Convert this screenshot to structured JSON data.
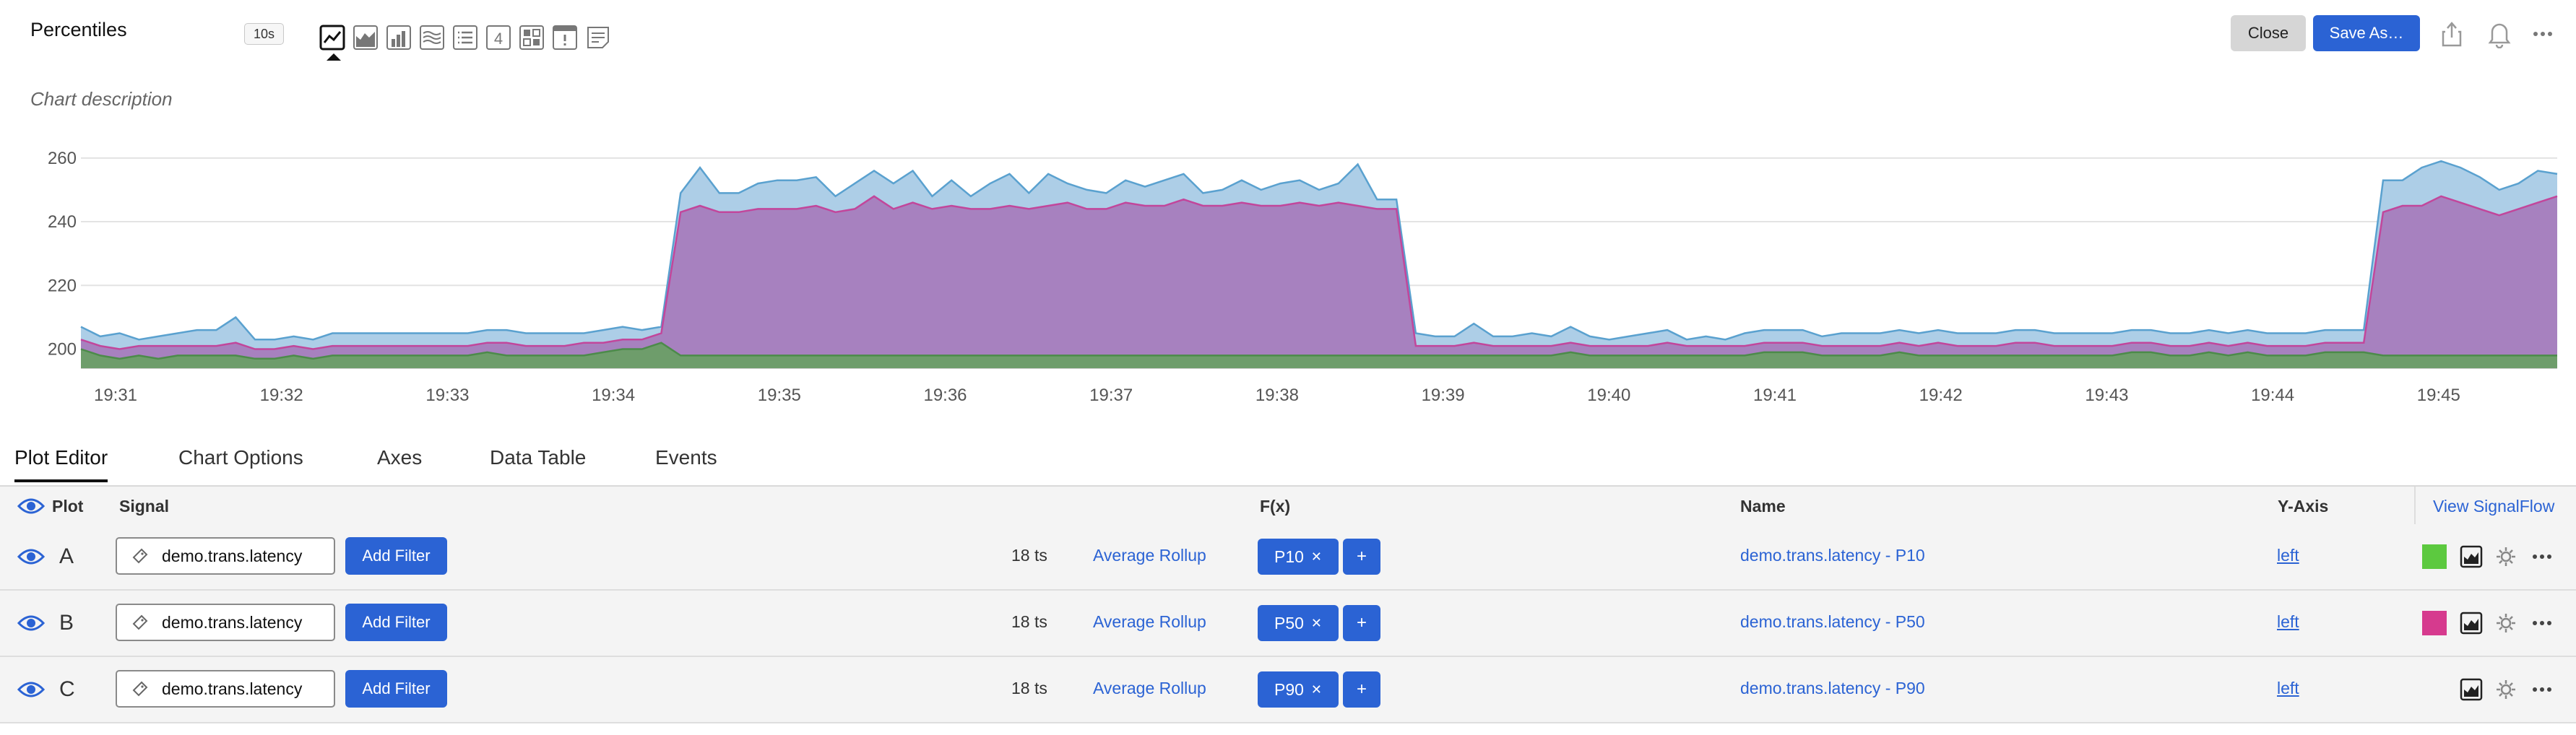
{
  "header": {
    "title": "Percentiles",
    "resolution": "10s",
    "description": "Chart description",
    "close_label": "Close",
    "save_as_label": "Save As…"
  },
  "viz_toolbar": [
    {
      "icon": "line-chart-icon",
      "active": true
    },
    {
      "icon": "area-chart-icon"
    },
    {
      "icon": "column-chart-icon"
    },
    {
      "icon": "histogram-icon"
    },
    {
      "icon": "list-icon"
    },
    {
      "icon": "single-value-icon",
      "glyph": "4"
    },
    {
      "icon": "heatmap-icon"
    },
    {
      "icon": "event-feed-icon"
    },
    {
      "icon": "text-note-icon"
    }
  ],
  "chart_data": {
    "type": "area",
    "title": "",
    "xlabel": "",
    "ylabel": "",
    "ylim": [
      194,
      262
    ],
    "yticks": [
      200,
      220,
      240,
      260
    ],
    "x_tick_labels": [
      "19:31",
      "19:32",
      "19:33",
      "19:34",
      "19:35",
      "19:36",
      "19:37",
      "19:38",
      "19:39",
      "19:40",
      "19:41",
      "19:42",
      "19:43",
      "19:44",
      "19:45"
    ],
    "grid": true,
    "stacked": false,
    "series": [
      {
        "name": "demo.trans.latency - P90",
        "color": "#a9cbe6",
        "line": "#5aa1cf",
        "values": [
          207,
          204,
          205,
          203,
          204,
          205,
          206,
          206,
          210,
          203,
          203,
          204,
          203,
          205,
          205,
          205,
          205,
          205,
          205,
          205,
          205,
          206,
          206,
          205,
          205,
          205,
          205,
          206,
          207,
          206,
          207,
          249,
          257,
          249,
          249,
          252,
          253,
          253,
          254,
          248,
          252,
          256,
          252,
          256,
          248,
          253,
          248,
          252,
          255,
          249,
          255,
          252,
          250,
          249,
          253,
          251,
          253,
          255,
          249,
          250,
          253,
          250,
          252,
          253,
          250,
          252,
          258,
          247,
          247,
          205,
          204,
          204,
          208,
          204,
          204,
          205,
          204,
          207,
          204,
          203,
          204,
          205,
          206,
          203,
          204,
          203,
          205,
          206,
          206,
          206,
          204,
          205,
          205,
          205,
          206,
          205,
          206,
          205,
          205,
          205,
          206,
          206,
          205,
          205,
          205,
          205,
          206,
          206,
          205,
          205,
          206,
          205,
          206,
          205,
          205,
          205,
          206,
          206,
          206,
          253,
          253,
          257,
          259,
          257,
          254,
          250,
          252,
          256,
          255
        ]
      },
      {
        "name": "demo.trans.latency - P50",
        "color": "#a77cbd",
        "line": "#c2469b",
        "values": [
          203,
          201,
          200,
          201,
          201,
          201,
          201,
          201,
          202,
          200,
          200,
          201,
          200,
          201,
          201,
          201,
          201,
          201,
          201,
          201,
          201,
          202,
          202,
          201,
          201,
          201,
          202,
          202,
          203,
          203,
          205,
          243,
          245,
          243,
          243,
          244,
          244,
          244,
          245,
          243,
          244,
          248,
          244,
          246,
          244,
          245,
          244,
          244,
          245,
          244,
          245,
          246,
          244,
          244,
          246,
          245,
          245,
          247,
          245,
          245,
          246,
          245,
          245,
          246,
          245,
          246,
          245,
          244,
          244,
          201,
          201,
          201,
          202,
          201,
          201,
          201,
          201,
          202,
          201,
          201,
          201,
          201,
          202,
          201,
          201,
          201,
          201,
          202,
          202,
          202,
          201,
          201,
          201,
          201,
          202,
          201,
          202,
          201,
          201,
          201,
          202,
          202,
          201,
          201,
          201,
          201,
          202,
          202,
          201,
          201,
          202,
          201,
          202,
          201,
          201,
          201,
          202,
          202,
          202,
          243,
          245,
          245,
          248,
          246,
          244,
          242,
          244,
          246,
          248
        ]
      },
      {
        "name": "demo.trans.latency - P10",
        "color": "#6a9e66",
        "line": "#4c8b4a",
        "values": [
          200,
          198,
          197,
          198,
          197,
          198,
          198,
          198,
          198,
          197,
          197,
          198,
          197,
          198,
          198,
          198,
          198,
          198,
          198,
          198,
          198,
          199,
          198,
          198,
          198,
          198,
          198,
          199,
          200,
          200,
          202,
          198,
          198,
          198,
          198,
          198,
          198,
          198,
          198,
          198,
          198,
          198,
          198,
          198,
          198,
          198,
          198,
          198,
          198,
          198,
          198,
          198,
          198,
          198,
          198,
          198,
          198,
          198,
          198,
          198,
          198,
          198,
          198,
          198,
          198,
          198,
          198,
          198,
          198,
          198,
          198,
          198,
          198,
          198,
          198,
          198,
          198,
          199,
          198,
          198,
          198,
          198,
          198,
          198,
          198,
          198,
          198,
          199,
          199,
          199,
          198,
          198,
          198,
          198,
          199,
          198,
          198,
          198,
          198,
          198,
          198,
          198,
          198,
          198,
          198,
          198,
          199,
          199,
          198,
          198,
          199,
          198,
          199,
          198,
          198,
          198,
          199,
          199,
          199,
          198,
          198,
          198,
          198,
          198,
          198,
          198,
          198,
          198,
          198
        ]
      }
    ]
  },
  "tabs": [
    "Plot Editor",
    "Chart Options",
    "Axes",
    "Data Table",
    "Events"
  ],
  "active_tab": "Plot Editor",
  "plot_table": {
    "headers": {
      "plot": "Plot",
      "signal": "Signal",
      "fx": "F(x)",
      "name": "Name",
      "yaxis": "Y-Axis",
      "view_signalflow": "View SignalFlow"
    },
    "rows": [
      {
        "letter": "A",
        "signal": "demo.trans.latency",
        "add_filter": "Add Filter",
        "ts_count": "18 ts",
        "rollup": "Average Rollup",
        "fx": "P10",
        "fx_remove": "✕",
        "fx_add": "+",
        "name": "demo.trans.latency - P10",
        "yaxis": "left",
        "color": "#5cc93f",
        "show_swatch": true
      },
      {
        "letter": "B",
        "signal": "demo.trans.latency",
        "add_filter": "Add Filter",
        "ts_count": "18 ts",
        "rollup": "Average Rollup",
        "fx": "P50",
        "fx_remove": "✕",
        "fx_add": "+",
        "name": "demo.trans.latency - P50",
        "yaxis": "left",
        "color": "#d63a8e",
        "show_swatch": true
      },
      {
        "letter": "C",
        "signal": "demo.trans.latency",
        "add_filter": "Add Filter",
        "ts_count": "18 ts",
        "rollup": "Average Rollup",
        "fx": "P90",
        "fx_remove": "✕",
        "fx_add": "+",
        "name": "demo.trans.latency - P90",
        "yaxis": "left",
        "color": "",
        "show_swatch": false
      }
    ]
  }
}
